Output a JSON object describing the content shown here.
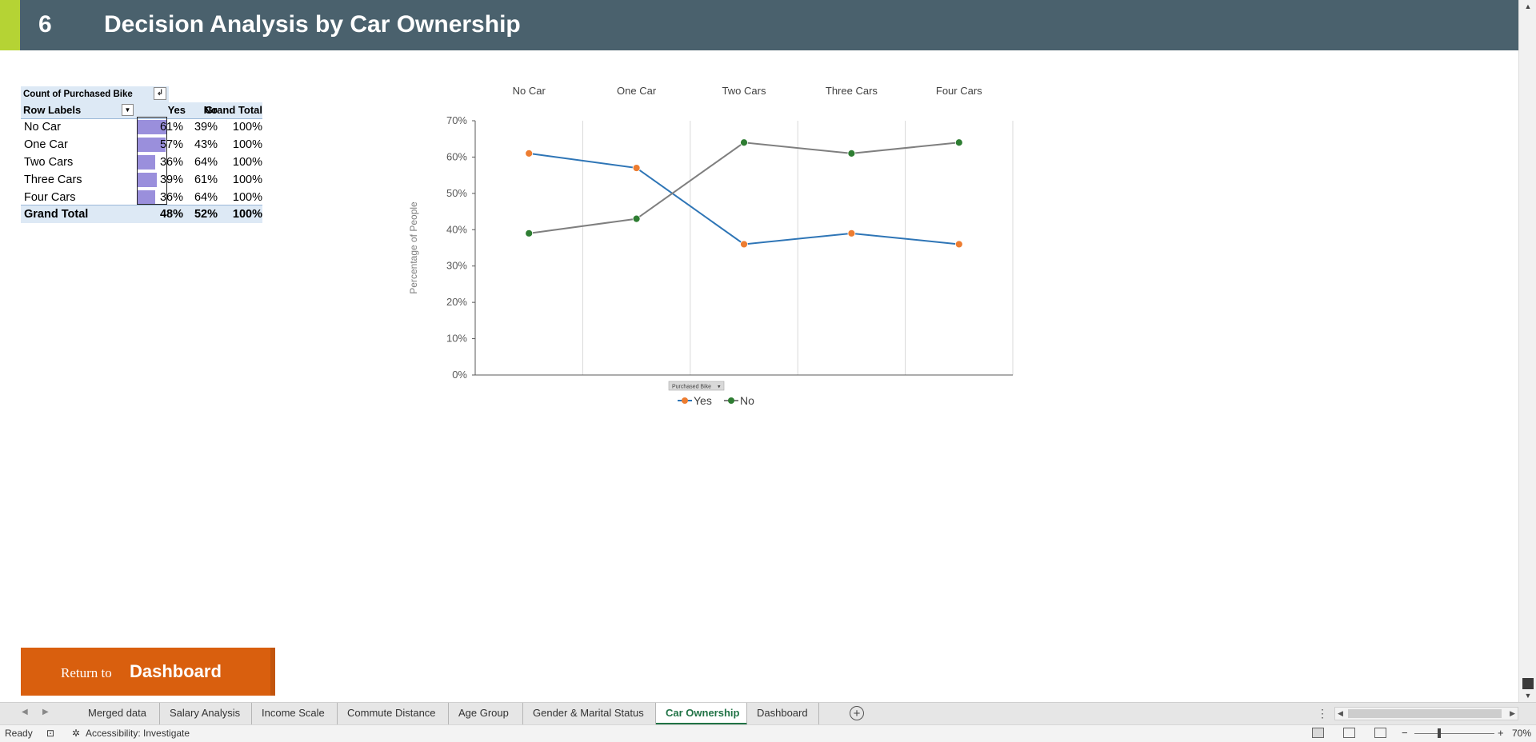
{
  "banner": {
    "number": "6",
    "title": "Decision Analysis by Car Ownership",
    "bg_color": "#4a616d",
    "accent_color": "#b5d334"
  },
  "pivot": {
    "caption": "Count of Purchased Bike",
    "headers": {
      "row_labels": "Row Labels",
      "yes": "Yes",
      "no": "No",
      "grand_total": "Grand Total"
    },
    "rows": [
      {
        "label": "No Car",
        "yes": "61%",
        "no": "39%",
        "total": "100%",
        "yes_fill": 0.61
      },
      {
        "label": "One Car",
        "yes": "57%",
        "no": "43%",
        "total": "100%",
        "yes_fill": 0.57
      },
      {
        "label": "Two Cars",
        "yes": "36%",
        "no": "64%",
        "total": "100%",
        "yes_fill": 0.36
      },
      {
        "label": "Three Cars",
        "yes": "39%",
        "no": "61%",
        "total": "100%",
        "yes_fill": 0.39
      },
      {
        "label": "Four Cars",
        "yes": "36%",
        "no": "64%",
        "total": "100%",
        "yes_fill": 0.36
      }
    ],
    "grand_total": {
      "label": "Grand Total",
      "yes": "48%",
      "no": "52%",
      "total": "100%"
    },
    "data_bar_color": "#9a8fdc"
  },
  "chart_data": {
    "type": "line",
    "categories": [
      "No Car",
      "One Car",
      "Two Cars",
      "Three Cars",
      "Four Cars"
    ],
    "series": [
      {
        "name": "Yes",
        "values": [
          0.61,
          0.57,
          0.36,
          0.39,
          0.36
        ],
        "line_color": "#2e75b6",
        "marker_color": "#ed7d31"
      },
      {
        "name": "No",
        "values": [
          0.39,
          0.43,
          0.64,
          0.61,
          0.64
        ],
        "line_color": "#7f7f7f",
        "marker_color": "#2e7d32"
      }
    ],
    "ylabel": "Percentage of People",
    "ylim": [
      0,
      0.7
    ],
    "yticks": [
      "0%",
      "10%",
      "20%",
      "30%",
      "40%",
      "50%",
      "60%",
      "70%"
    ],
    "category_labels_position": "top",
    "legend_position": "bottom",
    "field_button": "Purchased Bike"
  },
  "return_button": {
    "small": "Return to",
    "big": "Dashboard",
    "color": "#d95f0e"
  },
  "sheet_tabs": [
    {
      "label": "Merged data",
      "active": false
    },
    {
      "label": "Salary Analysis",
      "active": false
    },
    {
      "label": "Income Scale",
      "active": false
    },
    {
      "label": "Commute Distance",
      "active": false
    },
    {
      "label": "Age Group",
      "active": false
    },
    {
      "label": "Gender & Marital Status",
      "active": false
    },
    {
      "label": "Car Ownership",
      "active": true
    },
    {
      "label": "Dashboard",
      "active": false
    }
  ],
  "status": {
    "ready": "Ready",
    "accessibility": "Accessibility: Investigate",
    "zoom": "70%"
  }
}
